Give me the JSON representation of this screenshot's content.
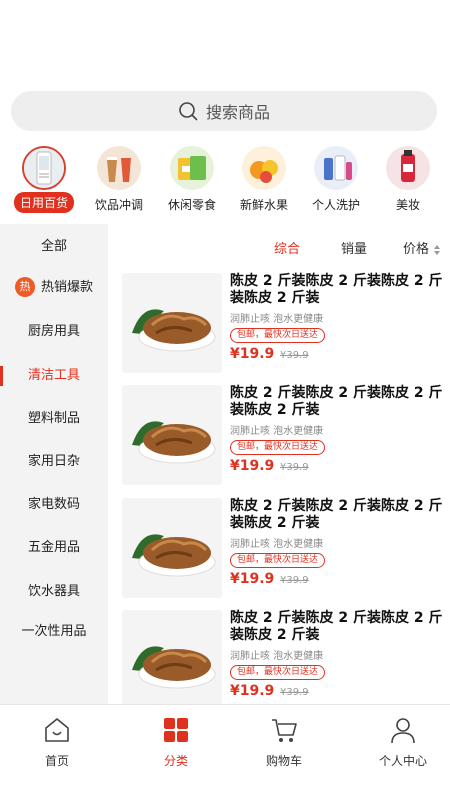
{
  "search": {
    "placeholder": "搜索商品"
  },
  "categories": [
    {
      "label": "日用百货",
      "icon": "air-conditioner-icon",
      "active": true
    },
    {
      "label": "饮品冲调",
      "icon": "drinks-icon"
    },
    {
      "label": "休闲零食",
      "icon": "snacks-icon"
    },
    {
      "label": "新鲜水果",
      "icon": "fruit-icon"
    },
    {
      "label": "个人洗护",
      "icon": "toiletries-icon"
    },
    {
      "label": "美妆",
      "icon": "cosmetics-icon"
    }
  ],
  "sidebar": {
    "items": [
      {
        "label": "全部"
      },
      {
        "label": "热销爆款",
        "badge": "热"
      },
      {
        "label": "厨房用具"
      },
      {
        "label": "清洁工具",
        "active": true
      },
      {
        "label": "塑料制品"
      },
      {
        "label": "家用日杂"
      },
      {
        "label": "家电数码"
      },
      {
        "label": "五金用品"
      },
      {
        "label": "饮水器具"
      },
      {
        "label": "一次性用品"
      }
    ]
  },
  "sort": {
    "comprehensive": "综合",
    "sales": "销量",
    "price": "价格"
  },
  "products": [
    {
      "title": "陈皮 2 斤装陈皮 2 斤装陈皮 2 斤装陈皮 2 斤装",
      "subtitle": "润肺止咳  泡水更健康",
      "tag": "包邮，最快次日送达",
      "price": "¥19.9",
      "old_price": "¥39.9"
    },
    {
      "title": "陈皮 2 斤装陈皮 2 斤装陈皮 2 斤装陈皮 2 斤装",
      "subtitle": "润肺止咳  泡水更健康",
      "tag": "包邮，最快次日送达",
      "price": "¥19.9",
      "old_price": "¥39.9"
    },
    {
      "title": "陈皮 2 斤装陈皮 2 斤装陈皮 2 斤装陈皮 2 斤装",
      "subtitle": "润肺止咳  泡水更健康",
      "tag": "包邮，最快次日送达",
      "price": "¥19.9",
      "old_price": "¥39.9"
    },
    {
      "title": "陈皮 2 斤装陈皮 2 斤装陈皮 2 斤装陈皮 2 斤装",
      "subtitle": "润肺止咳  泡水更健康",
      "tag": "包邮，最快次日送达",
      "price": "¥19.9",
      "old_price": "¥39.9"
    }
  ],
  "tabbar": {
    "home": "首页",
    "category": "分类",
    "cart": "购物车",
    "profile": "个人中心"
  },
  "colors": {
    "accent": "#e0301e"
  }
}
